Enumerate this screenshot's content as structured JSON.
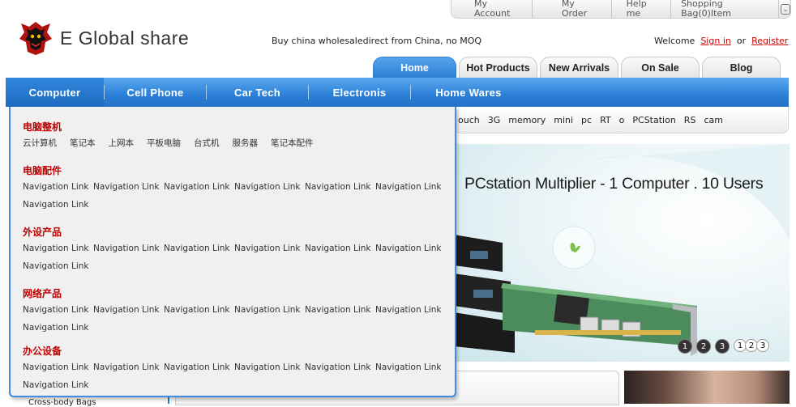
{
  "topbar": {
    "items": [
      "My Account",
      "My Order",
      "Help me",
      "Shopping Bag(0)Item"
    ],
    "dropdown_glyph": "⌄"
  },
  "logo": {
    "text": "E Global share"
  },
  "tagline": "Buy china wholesaledirect from China, no MOQ",
  "welcome": {
    "text": "Welcome",
    "sign_in": "Sign in",
    "or": "or",
    "register": "Register"
  },
  "tabs": [
    {
      "label": "Home",
      "active": true
    },
    {
      "label": "Hot Products"
    },
    {
      "label": "New Arrivals"
    },
    {
      "label": "On Sale"
    },
    {
      "label": "Blog"
    }
  ],
  "categories": [
    {
      "label": "Computer",
      "active": true
    },
    {
      "label": "Cell Phone"
    },
    {
      "label": "Car Tech"
    },
    {
      "label": "Electronis"
    },
    {
      "label": "Home Wares"
    }
  ],
  "keywords": [
    "ouch",
    "3G",
    "memory",
    "mini",
    "pc",
    "RT",
    "o",
    "PCStation",
    "RS",
    "cam"
  ],
  "banner": {
    "title": "PCstation Multiplier - 1 Computer . 10 Users",
    "dots": [
      "1",
      "2",
      "3"
    ],
    "small_dots": [
      "1",
      "2",
      "3"
    ]
  },
  "mega_menu": {
    "sections": [
      {
        "title": "电脑整机",
        "links": [
          "云计算机",
          "笔记本",
          "上网本",
          "平板电脑",
          "台式机",
          "服务器",
          "笔记本配件"
        ]
      },
      {
        "title": "电脑配件",
        "links": [
          "Navigation Link",
          "Navigation Link",
          "Navigation Link",
          "Navigation Link",
          "Navigation Link",
          "Navigation Link",
          "Navigation Link"
        ]
      },
      {
        "title": "外设产品",
        "links": [
          "Navigation Link",
          "Navigation Link",
          "Navigation Link",
          "Navigation Link",
          "Navigation Link",
          "Navigation Link",
          "Navigation Link"
        ]
      },
      {
        "title": "网络产品",
        "links": [
          "Navigation Link",
          "Navigation Link",
          "Navigation Link",
          "Navigation Link",
          "Navigation Link",
          "Navigation Link",
          "Navigation Link"
        ]
      },
      {
        "title": "办公设备",
        "links": [
          "Navigation Link",
          "Navigation Link",
          "Navigation Link",
          "Navigation Link",
          "Navigation Link",
          "Navigation Link",
          "Navigation Link"
        ]
      }
    ]
  },
  "sidebar_partial_link": "Cross-body Bags",
  "colors": {
    "accent_blue": "#2b7fd6",
    "section_red": "#c00000",
    "link_red": "#cc0000"
  }
}
